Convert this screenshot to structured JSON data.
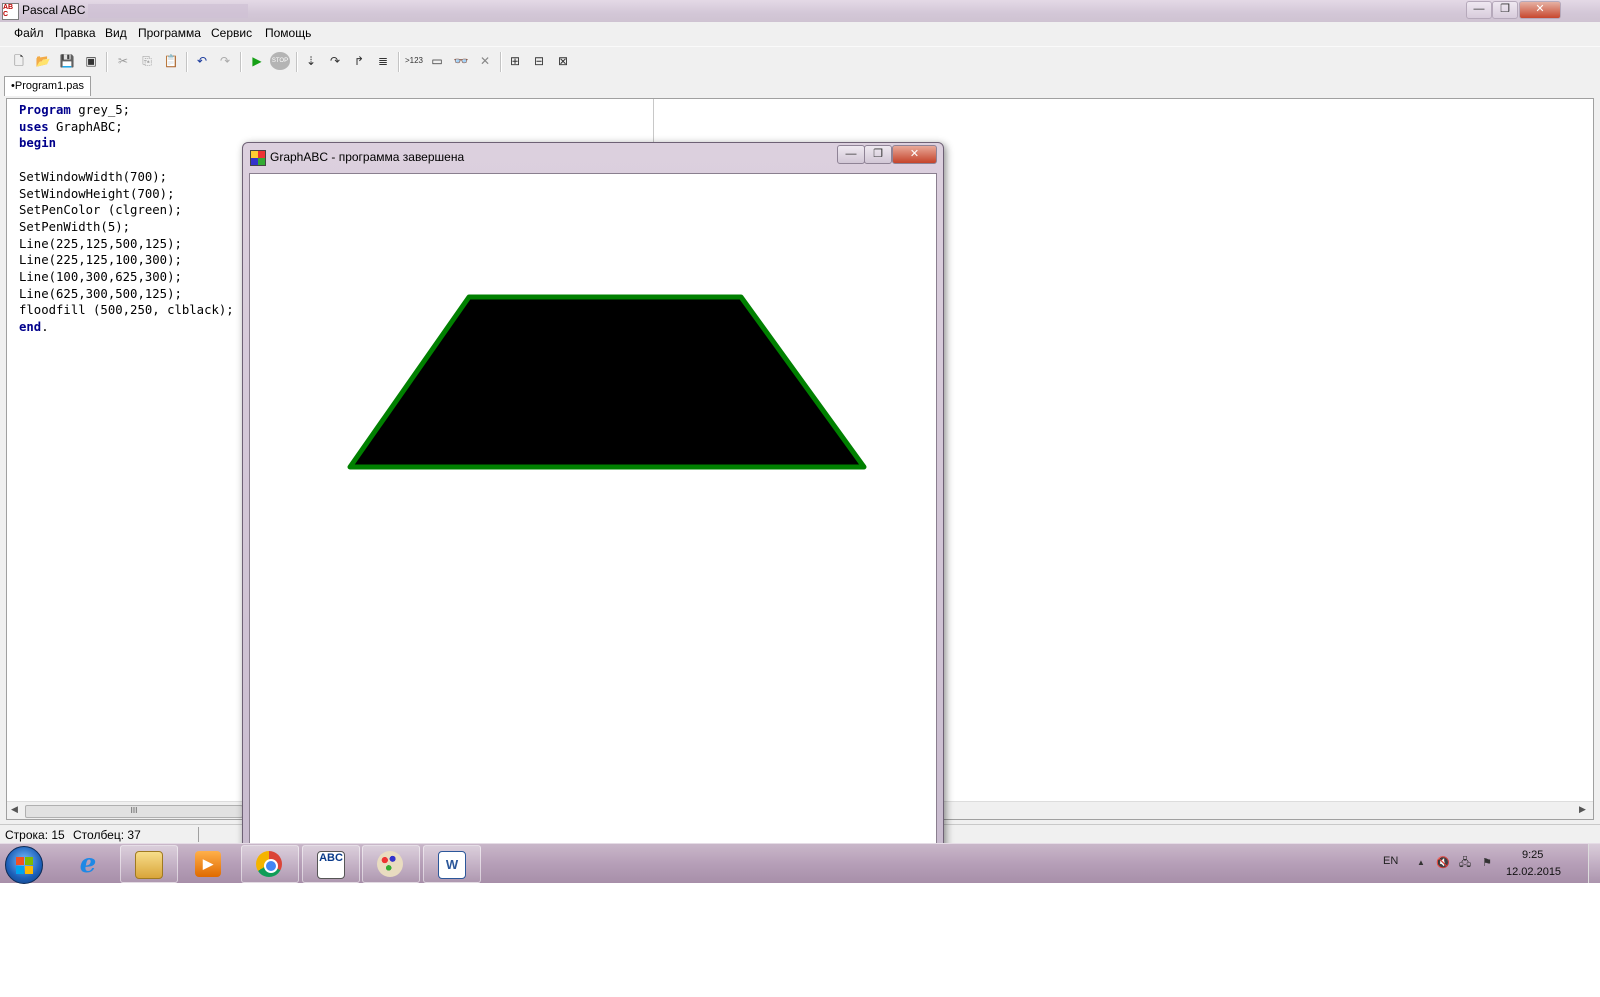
{
  "ide": {
    "title": "Pascal ABC",
    "window_buttons": {
      "minimize": "—",
      "maximize": "❐",
      "close": "✕"
    },
    "menu": [
      "Файл",
      "Правка",
      "Вид",
      "Программа",
      "Сервис",
      "Помощь"
    ],
    "toolbar": {
      "new": "🗋",
      "open": "📂",
      "save": "💾",
      "save_all": "▣",
      "cut": "✂",
      "copy": "⎘",
      "paste": "📋",
      "undo": "↶",
      "redo": "↷",
      "run": "▶",
      "stop": "STOP",
      "step_into": "⇣",
      "step_over": "↷",
      "step_out": "↱",
      "watch": "≣",
      "counter": ">123",
      "window": "▭",
      "glasses": "👓",
      "clear": "✕",
      "fmt1": "⊞",
      "fmt2": "⊟",
      "fmt3": "⊠"
    },
    "tab": "•Program1.pas",
    "code": {
      "l1_kw": "Program",
      "l1_rest": " grey_5;",
      "l2_kw": "uses",
      "l2_rest": " GraphABC;",
      "l3_kw": "begin",
      "l4": "",
      "l5": "SetWindowWidth(700);",
      "l6": "SetWindowHeight(700);",
      "l7": "SetPenColor (clgreen);",
      "l8": "SetPenWidth(5);",
      "l9": "Line(225,125,500,125);",
      "l10": "Line(225,125,100,300);",
      "l11": "Line(100,300,625,300);",
      "l12": "Line(625,300,500,125);",
      "l13": "floodfill (500,250, clblack);",
      "l14_kw": "end",
      "l14_rest": "."
    },
    "scroll_thumb": "III",
    "status": {
      "row": "Строка: 15",
      "col": "Столбец: 37"
    }
  },
  "graph_window": {
    "title": "GraphABC - программа завершена",
    "buttons": {
      "minimize": "—",
      "maximize": "❐",
      "close": "✕"
    },
    "colors": {
      "pen": "#008000",
      "fill": "#000000"
    }
  },
  "taskbar": {
    "apps": [
      "internet-explorer",
      "file-explorer",
      "media-player",
      "chrome",
      "pascal-abc",
      "paint",
      "word"
    ],
    "abc_label": "ABC",
    "word_label": "W",
    "tray": {
      "lang": "EN",
      "time": "9:25",
      "date": "12.02.2015",
      "up_arrow": "▲",
      "volume": "🔇",
      "network": "🖧",
      "flag": "⚑"
    }
  }
}
